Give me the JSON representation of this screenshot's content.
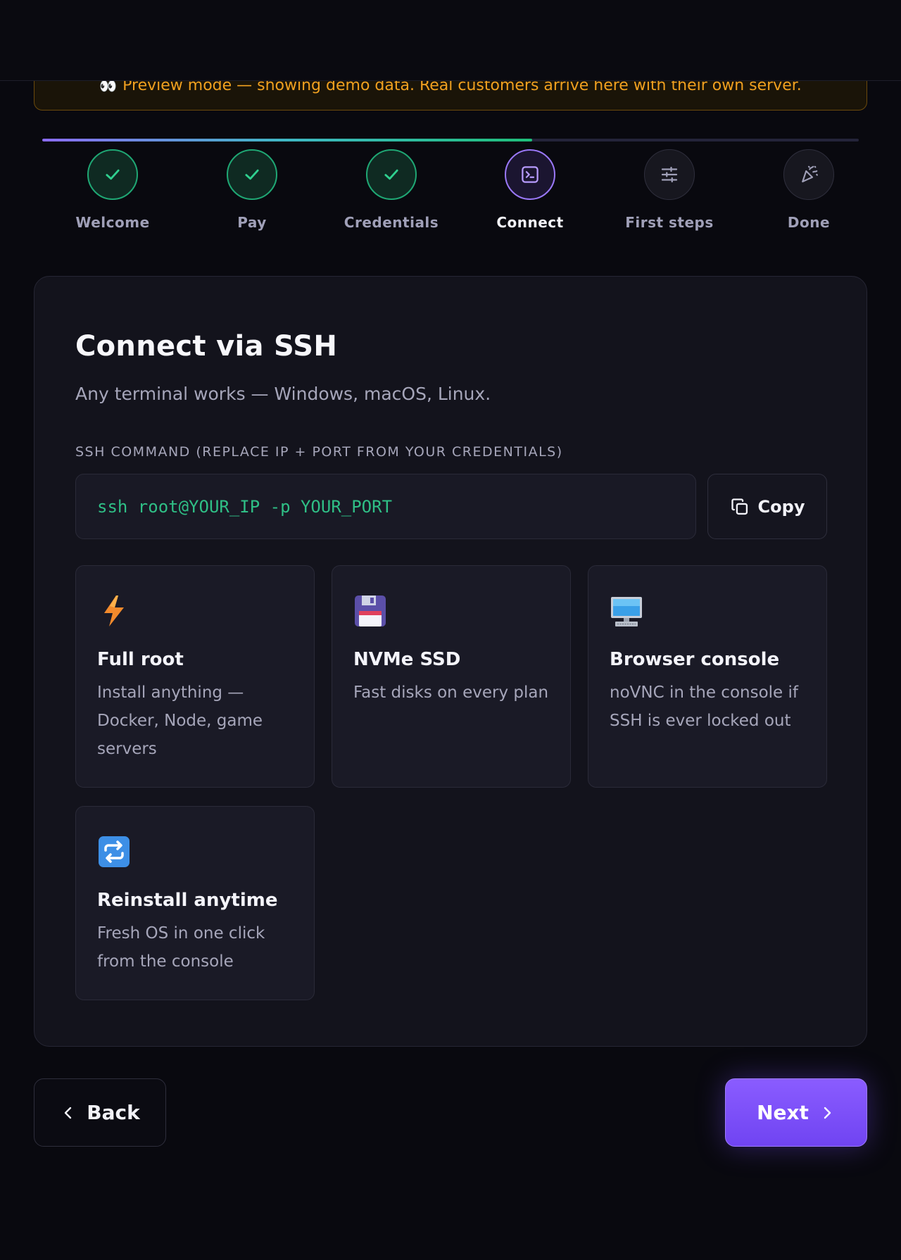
{
  "banner": {
    "icon": "eyes-icon",
    "text": "Preview mode — showing demo data. Real customers arrive here with their own server."
  },
  "progress": {
    "fraction": 0.6
  },
  "steps": [
    {
      "label": "Welcome",
      "state": "done",
      "icon": "check-icon"
    },
    {
      "label": "Pay",
      "state": "done",
      "icon": "check-icon"
    },
    {
      "label": "Credentials",
      "state": "done",
      "icon": "check-icon"
    },
    {
      "label": "Connect",
      "state": "current",
      "icon": "terminal-icon"
    },
    {
      "label": "First steps",
      "state": "todo",
      "icon": "sliders-icon"
    },
    {
      "label": "Done",
      "state": "todo",
      "icon": "party-popper-icon"
    }
  ],
  "main": {
    "title": "Connect via SSH",
    "subtitle": "Any terminal works — Windows, macOS, Linux.",
    "command_label": "SSH COMMAND (REPLACE IP + PORT FROM YOUR CREDENTIALS)",
    "command": "ssh root@YOUR_IP -p YOUR_PORT",
    "copy_label": "Copy"
  },
  "features": [
    {
      "icon": "lightning-icon",
      "name": "Full root",
      "desc": "Install anything — Docker, Node, game servers"
    },
    {
      "icon": "floppy-disk-icon",
      "name": "NVMe SSD",
      "desc": "Fast disks on every plan"
    },
    {
      "icon": "desktop-computer-icon",
      "name": "Browser console",
      "desc": "noVNC in the console if SSH is ever locked out"
    },
    {
      "icon": "repeat-icon",
      "name": "Reinstall anytime",
      "desc": "Fresh OS in one click from the console"
    }
  ],
  "nav": {
    "back_label": "Back",
    "next_label": "Next"
  },
  "colors": {
    "accent": "#7c4dff",
    "success": "#1fa774",
    "warning": "#f0a020",
    "command_text": "#2fbf86"
  }
}
